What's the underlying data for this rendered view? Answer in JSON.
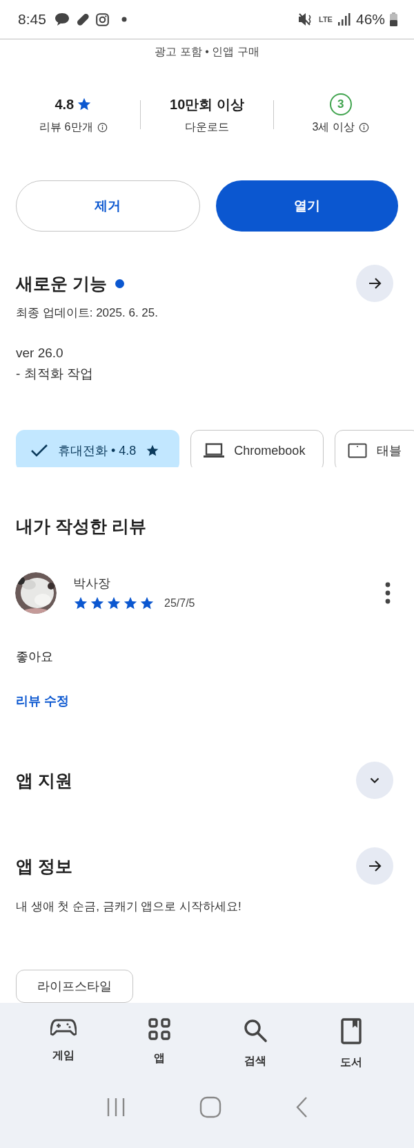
{
  "status_bar": {
    "time": "8:45",
    "network": "LTE",
    "battery": "46%"
  },
  "tags_line": "광고 포함 • 인앱 구매",
  "stats": [
    {
      "kind": "rating",
      "value": "4.8",
      "label": "리뷰 6만개",
      "info": true
    },
    {
      "kind": "text",
      "value": "10만회 이상",
      "label": "다운로드",
      "info": false
    },
    {
      "kind": "age",
      "value": "3",
      "label": "3세 이상",
      "info": true
    }
  ],
  "buttons": [
    {
      "kind": "outline",
      "label": "제거"
    },
    {
      "kind": "filled",
      "label": "열기"
    }
  ],
  "whats_new": {
    "title": "새로운 기능",
    "updated": "최종 업데이트: 2025. 6. 25.",
    "notes": [
      "ver 26.0",
      "- 최적화 작업"
    ]
  },
  "device_chips": [
    {
      "label": "휴대전화 • 4.8",
      "star": true,
      "selected": true
    },
    {
      "kind": "laptop",
      "label": "Chromebook",
      "star": false,
      "selected": false
    },
    {
      "kind": "tablet",
      "label": "태블",
      "star": false,
      "selected": false
    }
  ],
  "my_review": {
    "title": "내가 작성한 리뷰",
    "author": "박사장",
    "stars": 5,
    "date": "25/7/5",
    "text": "좋아요",
    "edit_link": "리뷰 수정"
  },
  "sections": [
    {
      "title": "앱 지원",
      "kind": "expand"
    },
    {
      "title": "앱 정보",
      "kind": "open",
      "description": "내 생애 첫 순금, 금캐기 앱으로 시작하세요!"
    }
  ],
  "category_chips": [
    "라이프스타일"
  ],
  "bottom_nav": [
    {
      "kind": "games",
      "label": "게임"
    },
    {
      "kind": "apps",
      "label": "앱"
    },
    {
      "kind": "search",
      "label": "검색"
    },
    {
      "kind": "books",
      "label": "도서"
    }
  ]
}
